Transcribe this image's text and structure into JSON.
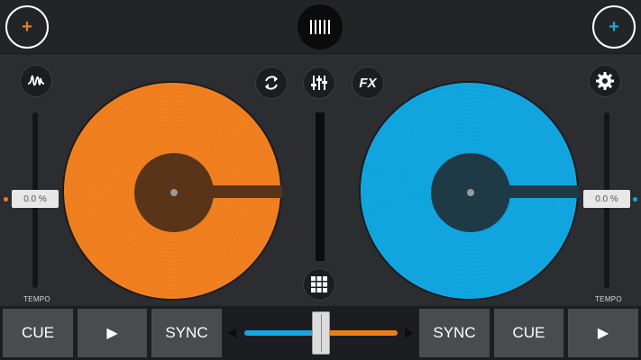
{
  "top_bar": {
    "add_left_icon": "plus-icon",
    "add_left_label": "+",
    "library_icon": "library-bars-icon",
    "add_right_icon": "plus-icon",
    "add_right_label": "+"
  },
  "controls": {
    "waveform_icon": "waveform-icon",
    "loop_icon": "loop-icon",
    "mixer_icon": "mixer-sliders-icon",
    "fx_label": "FX",
    "settings_icon": "gear-icon",
    "sampler_icon": "grid-icon"
  },
  "deck_left": {
    "color": "#f07d1a",
    "pitch_value": "0.0 %",
    "tempo_label": "TEMPO"
  },
  "deck_right": {
    "color": "#16a6e3",
    "pitch_value": "0.0 %",
    "tempo_label": "TEMPO"
  },
  "bottom": {
    "left": {
      "cue": "CUE",
      "play": "▶",
      "sync": "SYNC"
    },
    "right": {
      "sync": "SYNC",
      "cue": "CUE",
      "play": "▶"
    }
  }
}
